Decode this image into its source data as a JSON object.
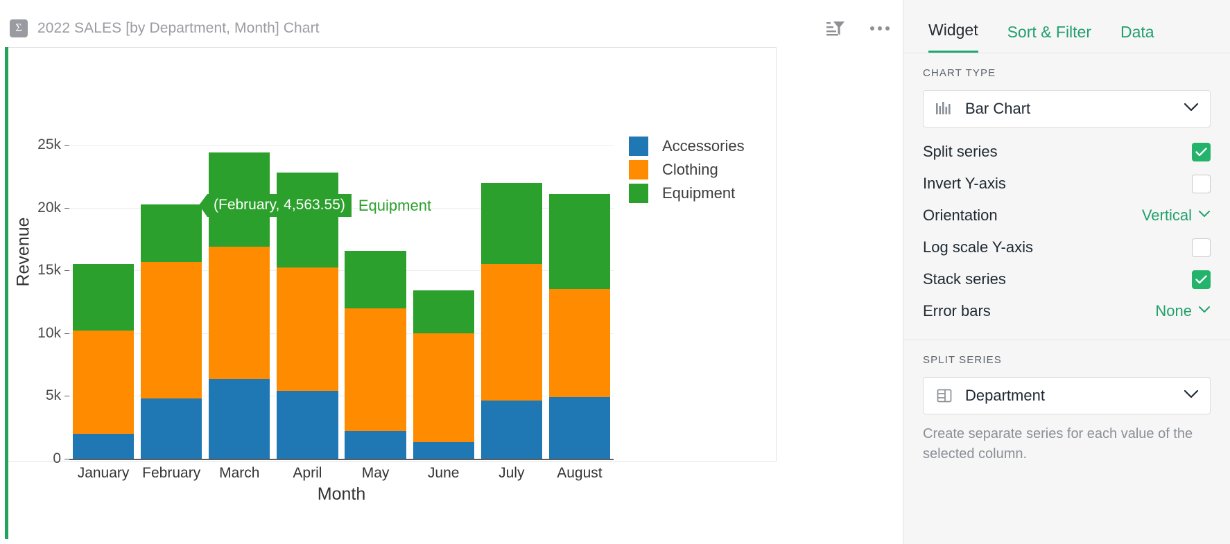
{
  "widget": {
    "icon": "sigma-icon",
    "title": "2022 SALES [by Department, Month] Chart",
    "actions": {
      "sort_filter_icon": "sort-filter-icon",
      "more_icon": "more-options-icon"
    }
  },
  "chart_data": {
    "type": "bar",
    "subtype": "stacked-bar",
    "title": "",
    "xlabel": "Month",
    "ylabel": "Revenue",
    "ylim": [
      0,
      26500
    ],
    "yticks": [
      0,
      5000,
      10000,
      15000,
      20000,
      25000
    ],
    "ytick_labels": [
      "0",
      "5k",
      "10k",
      "15k",
      "20k",
      "25k"
    ],
    "grid": true,
    "legend_position": "right",
    "categories": [
      "January",
      "February",
      "March",
      "April",
      "May",
      "June",
      "July",
      "August"
    ],
    "series": [
      {
        "name": "Accessories",
        "color": "#1f77b4",
        "values": [
          2000,
          4800,
          6350,
          5400,
          2200,
          1300,
          4650,
          4900
        ]
      },
      {
        "name": "Clothing",
        "color": "#ff8c00",
        "values": [
          8200,
          10900,
          10550,
          9850,
          9800,
          8700,
          10850,
          8600
        ]
      },
      {
        "name": "Equipment",
        "color": "#2ca02c",
        "values": [
          5300,
          4563.55,
          7500,
          7550,
          4550,
          3400,
          6500,
          7600
        ]
      }
    ],
    "annotation": {
      "label": "(February, 4,563.55)",
      "series": "Equipment",
      "color": "#2ca02c"
    }
  },
  "panel": {
    "tabs": [
      {
        "label": "Widget",
        "active": true
      },
      {
        "label": "Sort & Filter",
        "active": false
      },
      {
        "label": "Data",
        "active": false
      }
    ],
    "chart_type": {
      "section_title": "CHART TYPE",
      "icon": "bar-chart-icon",
      "value": "Bar Chart"
    },
    "options": [
      {
        "label": "Split series",
        "control": "checkbox",
        "checked": true
      },
      {
        "label": "Invert Y-axis",
        "control": "checkbox",
        "checked": false
      },
      {
        "label": "Orientation",
        "control": "dropdown",
        "value": "Vertical"
      },
      {
        "label": "Log scale Y-axis",
        "control": "checkbox",
        "checked": false
      },
      {
        "label": "Stack series",
        "control": "checkbox",
        "checked": true
      },
      {
        "label": "Error bars",
        "control": "dropdown",
        "value": "None"
      }
    ],
    "split_series": {
      "section_title": "SPLIT SERIES",
      "icon": "column-icon",
      "value": "Department",
      "hint": "Create separate series for each value of the selected column."
    }
  },
  "colors": {
    "accent_green": "#22a45d",
    "tab_green": "#22a06b",
    "checkbox_green": "#24b36b",
    "title_gray": "#9b9ca1"
  }
}
